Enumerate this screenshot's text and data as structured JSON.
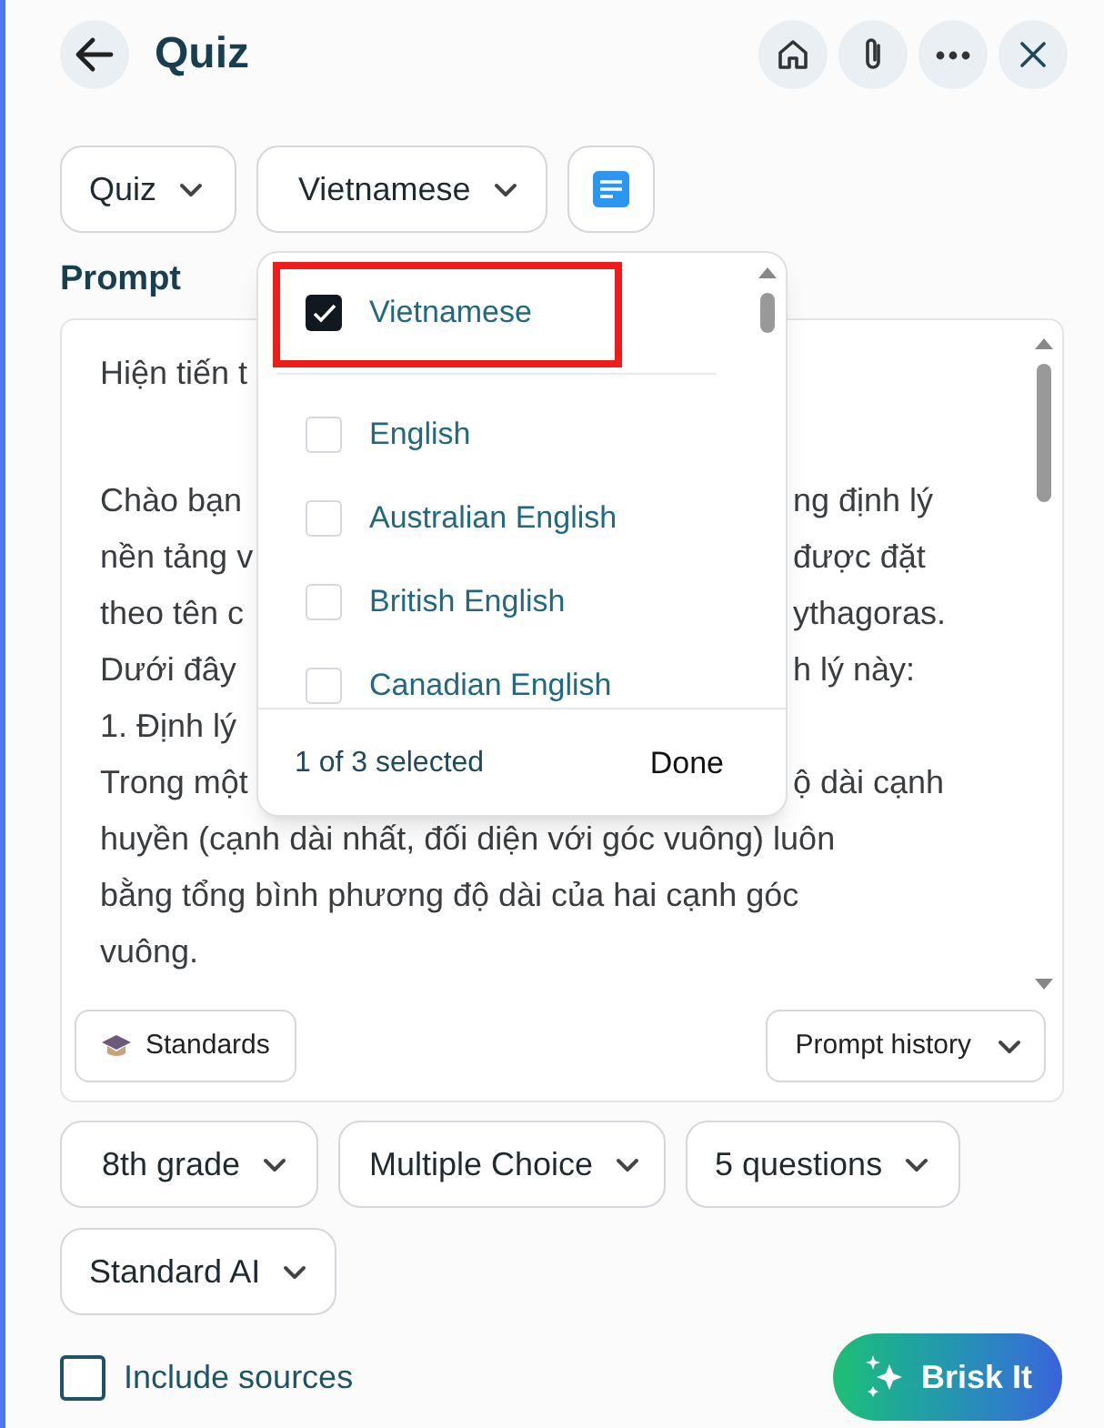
{
  "header": {
    "title": "Quiz"
  },
  "toolbar": {
    "tool_select": "Quiz",
    "language_select": "Vietnamese"
  },
  "prompt": {
    "label": "Prompt",
    "lines": [
      {
        "left": "Hiện tiến t",
        "blank_before": false
      },
      {
        "left": "Chào bạn",
        "right": "ng định lý",
        "blank_before": true
      },
      {
        "left": "nền tảng v",
        "right": "được đặt",
        "blank_before": false
      },
      {
        "left": "theo tên c",
        "right": "ythagoras.",
        "blank_before": false
      },
      {
        "left": "Dưới đây",
        "right": "h lý này:",
        "blank_before": false
      },
      {
        "left": "1. Định lý",
        "blank_before": false
      },
      {
        "left": "Trong một",
        "right": "ộ dài cạnh",
        "blank_before": false
      },
      {
        "left": "huyền (cạnh dài nhất, đối diện với góc vuông) luôn",
        "blank_before": false
      },
      {
        "left": "bằng tổng bình phương độ dài của hai cạnh góc",
        "blank_before": false
      },
      {
        "left": "vuông.",
        "blank_before": false
      }
    ],
    "standards_button": "Standards",
    "history_button": "Prompt history"
  },
  "language_menu": {
    "options": [
      {
        "label": "Vietnamese",
        "checked": true,
        "highlighted": true
      },
      {
        "label": "English",
        "checked": false,
        "highlighted": false
      },
      {
        "label": "Australian English",
        "checked": false,
        "highlighted": false
      },
      {
        "label": "British English",
        "checked": false,
        "highlighted": false
      },
      {
        "label": "Canadian English",
        "checked": false,
        "highlighted": false
      }
    ],
    "count": "1 of 3 selected",
    "done": "Done"
  },
  "settings": [
    "8th grade",
    "Multiple Choice",
    "5 questions",
    "Standard AI"
  ],
  "include_sources": {
    "label": "Include sources",
    "checked": false
  },
  "submit": "Brisk It"
}
